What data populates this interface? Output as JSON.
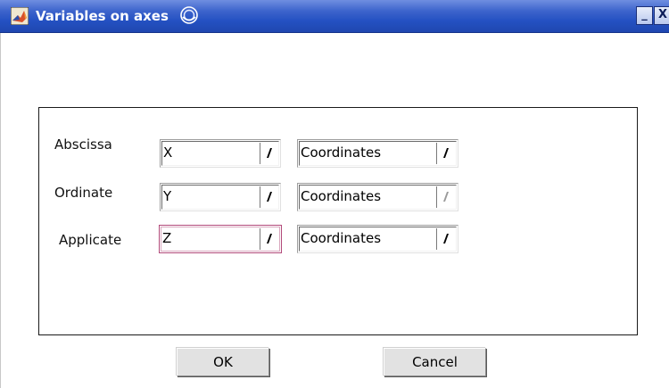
{
  "window": {
    "title": "Variables on axes",
    "minimize_glyph": "_",
    "close_glyph": "X",
    "app_icon": "matlab-logo-icon",
    "extra_icon": "roll-up-swirl-icon"
  },
  "rows": [
    {
      "label": "Abscissa",
      "variable": "X",
      "type": "Coordinates"
    },
    {
      "label": "Ordinate",
      "variable": "Y",
      "type": "Coordinates"
    },
    {
      "label": "Applicate",
      "variable": "Z",
      "type": "Coordinates"
    }
  ],
  "buttons": {
    "ok": "OK",
    "cancel": "Cancel"
  },
  "colors": {
    "titlebar": "#2451c2",
    "focus_border": "#b24a7a"
  }
}
